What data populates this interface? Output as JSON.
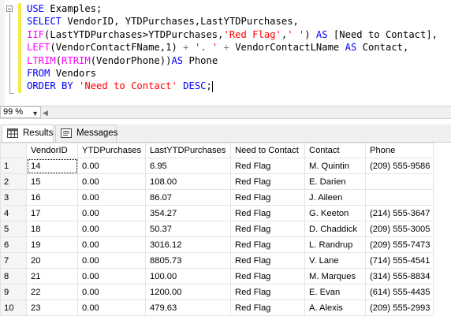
{
  "editor": {
    "lines": [
      [
        {
          "t": "USE ",
          "c": "k"
        },
        {
          "t": "Examples;",
          "c": ""
        }
      ],
      [
        {
          "t": "SELECT ",
          "c": "k"
        },
        {
          "t": "VendorID, YTDPurchases,LastYTDPurchases,",
          "c": ""
        }
      ],
      [
        {
          "t": "IIF",
          "c": "f"
        },
        {
          "t": "(LastYTDPurchases>YTDPurchases,",
          "c": ""
        },
        {
          "t": "'Red Flag'",
          "c": "s"
        },
        {
          "t": ",",
          "c": ""
        },
        {
          "t": "' '",
          "c": "s"
        },
        {
          "t": ") ",
          "c": ""
        },
        {
          "t": "AS",
          "c": "k"
        },
        {
          "t": " [Need to Contact],",
          "c": ""
        }
      ],
      [
        {
          "t": "LEFT",
          "c": "f"
        },
        {
          "t": "(VendorContactFName,1) ",
          "c": ""
        },
        {
          "t": "+",
          "c": "g"
        },
        {
          "t": " ",
          "c": ""
        },
        {
          "t": "'. '",
          "c": "s"
        },
        {
          "t": " ",
          "c": ""
        },
        {
          "t": "+",
          "c": "g"
        },
        {
          "t": " VendorContactLName ",
          "c": ""
        },
        {
          "t": "AS",
          "c": "k"
        },
        {
          "t": " Contact,",
          "c": ""
        }
      ],
      [
        {
          "t": "LTRIM",
          "c": "f"
        },
        {
          "t": "(",
          "c": ""
        },
        {
          "t": "RTRIM",
          "c": "f"
        },
        {
          "t": "(VendorPhone))",
          "c": ""
        },
        {
          "t": "AS",
          "c": "k"
        },
        {
          "t": " Phone",
          "c": ""
        }
      ],
      [
        {
          "t": "FROM ",
          "c": "k"
        },
        {
          "t": "Vendors",
          "c": ""
        }
      ],
      [
        {
          "t": "ORDER BY ",
          "c": "k"
        },
        {
          "t": "'Need to Contact'",
          "c": "s"
        },
        {
          "t": " ",
          "c": ""
        },
        {
          "t": "DESC",
          "c": "k"
        },
        {
          "t": ";",
          "c": ""
        }
      ]
    ]
  },
  "zoom": {
    "value": "99 %"
  },
  "tabs": {
    "results": "Results",
    "messages": "Messages"
  },
  "grid": {
    "columns": [
      "VendorID",
      "YTDPurchases",
      "LastYTDPurchases",
      "Need to Contact",
      "Contact",
      "Phone"
    ],
    "rows": [
      [
        "1",
        "14",
        "0.00",
        "6.95",
        "Red Flag",
        "M. Quintin",
        "(209) 555-9586"
      ],
      [
        "2",
        "15",
        "0.00",
        "108.00",
        "Red Flag",
        "E. Darien",
        ""
      ],
      [
        "3",
        "16",
        "0.00",
        "86.07",
        "Red Flag",
        "J. Aileen",
        ""
      ],
      [
        "4",
        "17",
        "0.00",
        "354.27",
        "Red Flag",
        "G. Keeton",
        "(214) 555-3647"
      ],
      [
        "5",
        "18",
        "0.00",
        "50.37",
        "Red Flag",
        "D. Chaddick",
        "(209) 555-3005"
      ],
      [
        "6",
        "19",
        "0.00",
        "3016.12",
        "Red Flag",
        "L. Randrup",
        "(209) 555-7473"
      ],
      [
        "7",
        "20",
        "0.00",
        "8805.73",
        "Red Flag",
        "V. Lane",
        "(714) 555-4541"
      ],
      [
        "8",
        "21",
        "0.00",
        "100.00",
        "Red Flag",
        "M. Marques",
        "(314) 555-8834"
      ],
      [
        "9",
        "22",
        "0.00",
        "1200.00",
        "Red Flag",
        "E. Evan",
        "(614) 555-4435"
      ],
      [
        "10",
        "23",
        "0.00",
        "479.63",
        "Red Flag",
        "A. Alexis",
        "(209) 555-2993"
      ]
    ]
  },
  "colors": {
    "keyword": "#0000ff",
    "string": "#ff0000",
    "function": "#ff00ff",
    "operator": "#808080"
  }
}
